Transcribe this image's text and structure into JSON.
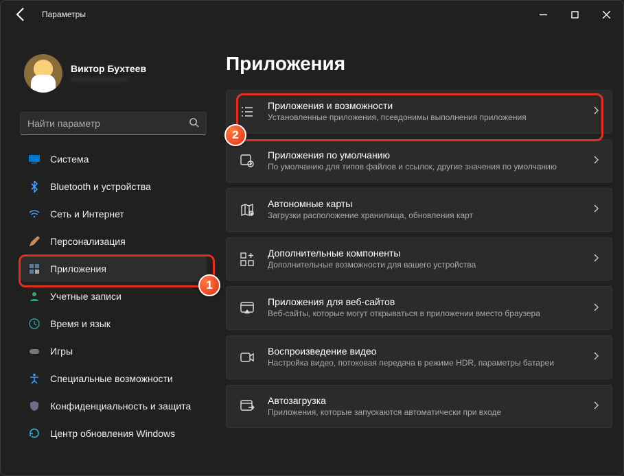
{
  "window": {
    "title": "Параметры"
  },
  "profile": {
    "name": "Виктор Бухтеев",
    "sub": "———————"
  },
  "search": {
    "placeholder": "Найти параметр"
  },
  "nav": {
    "items": [
      {
        "label": "Система"
      },
      {
        "label": "Bluetooth и устройства"
      },
      {
        "label": "Сеть и Интернет"
      },
      {
        "label": "Персонализация"
      },
      {
        "label": "Приложения"
      },
      {
        "label": "Учетные записи"
      },
      {
        "label": "Время и язык"
      },
      {
        "label": "Игры"
      },
      {
        "label": "Специальные возможности"
      },
      {
        "label": "Конфиденциальность и защита"
      },
      {
        "label": "Центр обновления Windows"
      }
    ]
  },
  "main": {
    "heading": "Приложения",
    "cards": [
      {
        "title": "Приложения и возможности",
        "sub": "Установленные приложения, псевдонимы выполнения приложения"
      },
      {
        "title": "Приложения по умолчанию",
        "sub": "По умолчанию для типов файлов и ссылок, другие значения по умолчанию"
      },
      {
        "title": "Автономные карты",
        "sub": "Загрузки расположение хранилища, обновления карт"
      },
      {
        "title": "Дополнительные компоненты",
        "sub": "Дополнительные возможности для вашего устройства"
      },
      {
        "title": "Приложения для веб-сайтов",
        "sub": "Веб-сайты, которые могут открываться в приложении вместо браузера"
      },
      {
        "title": "Воспроизведение видео",
        "sub": "Настройка видео, потоковая передача в режиме HDR, параметры батареи"
      },
      {
        "title": "Автозагрузка",
        "sub": "Приложения, которые запускаются автоматически при входе"
      }
    ]
  },
  "annotations": {
    "step1": "1",
    "step2": "2"
  }
}
